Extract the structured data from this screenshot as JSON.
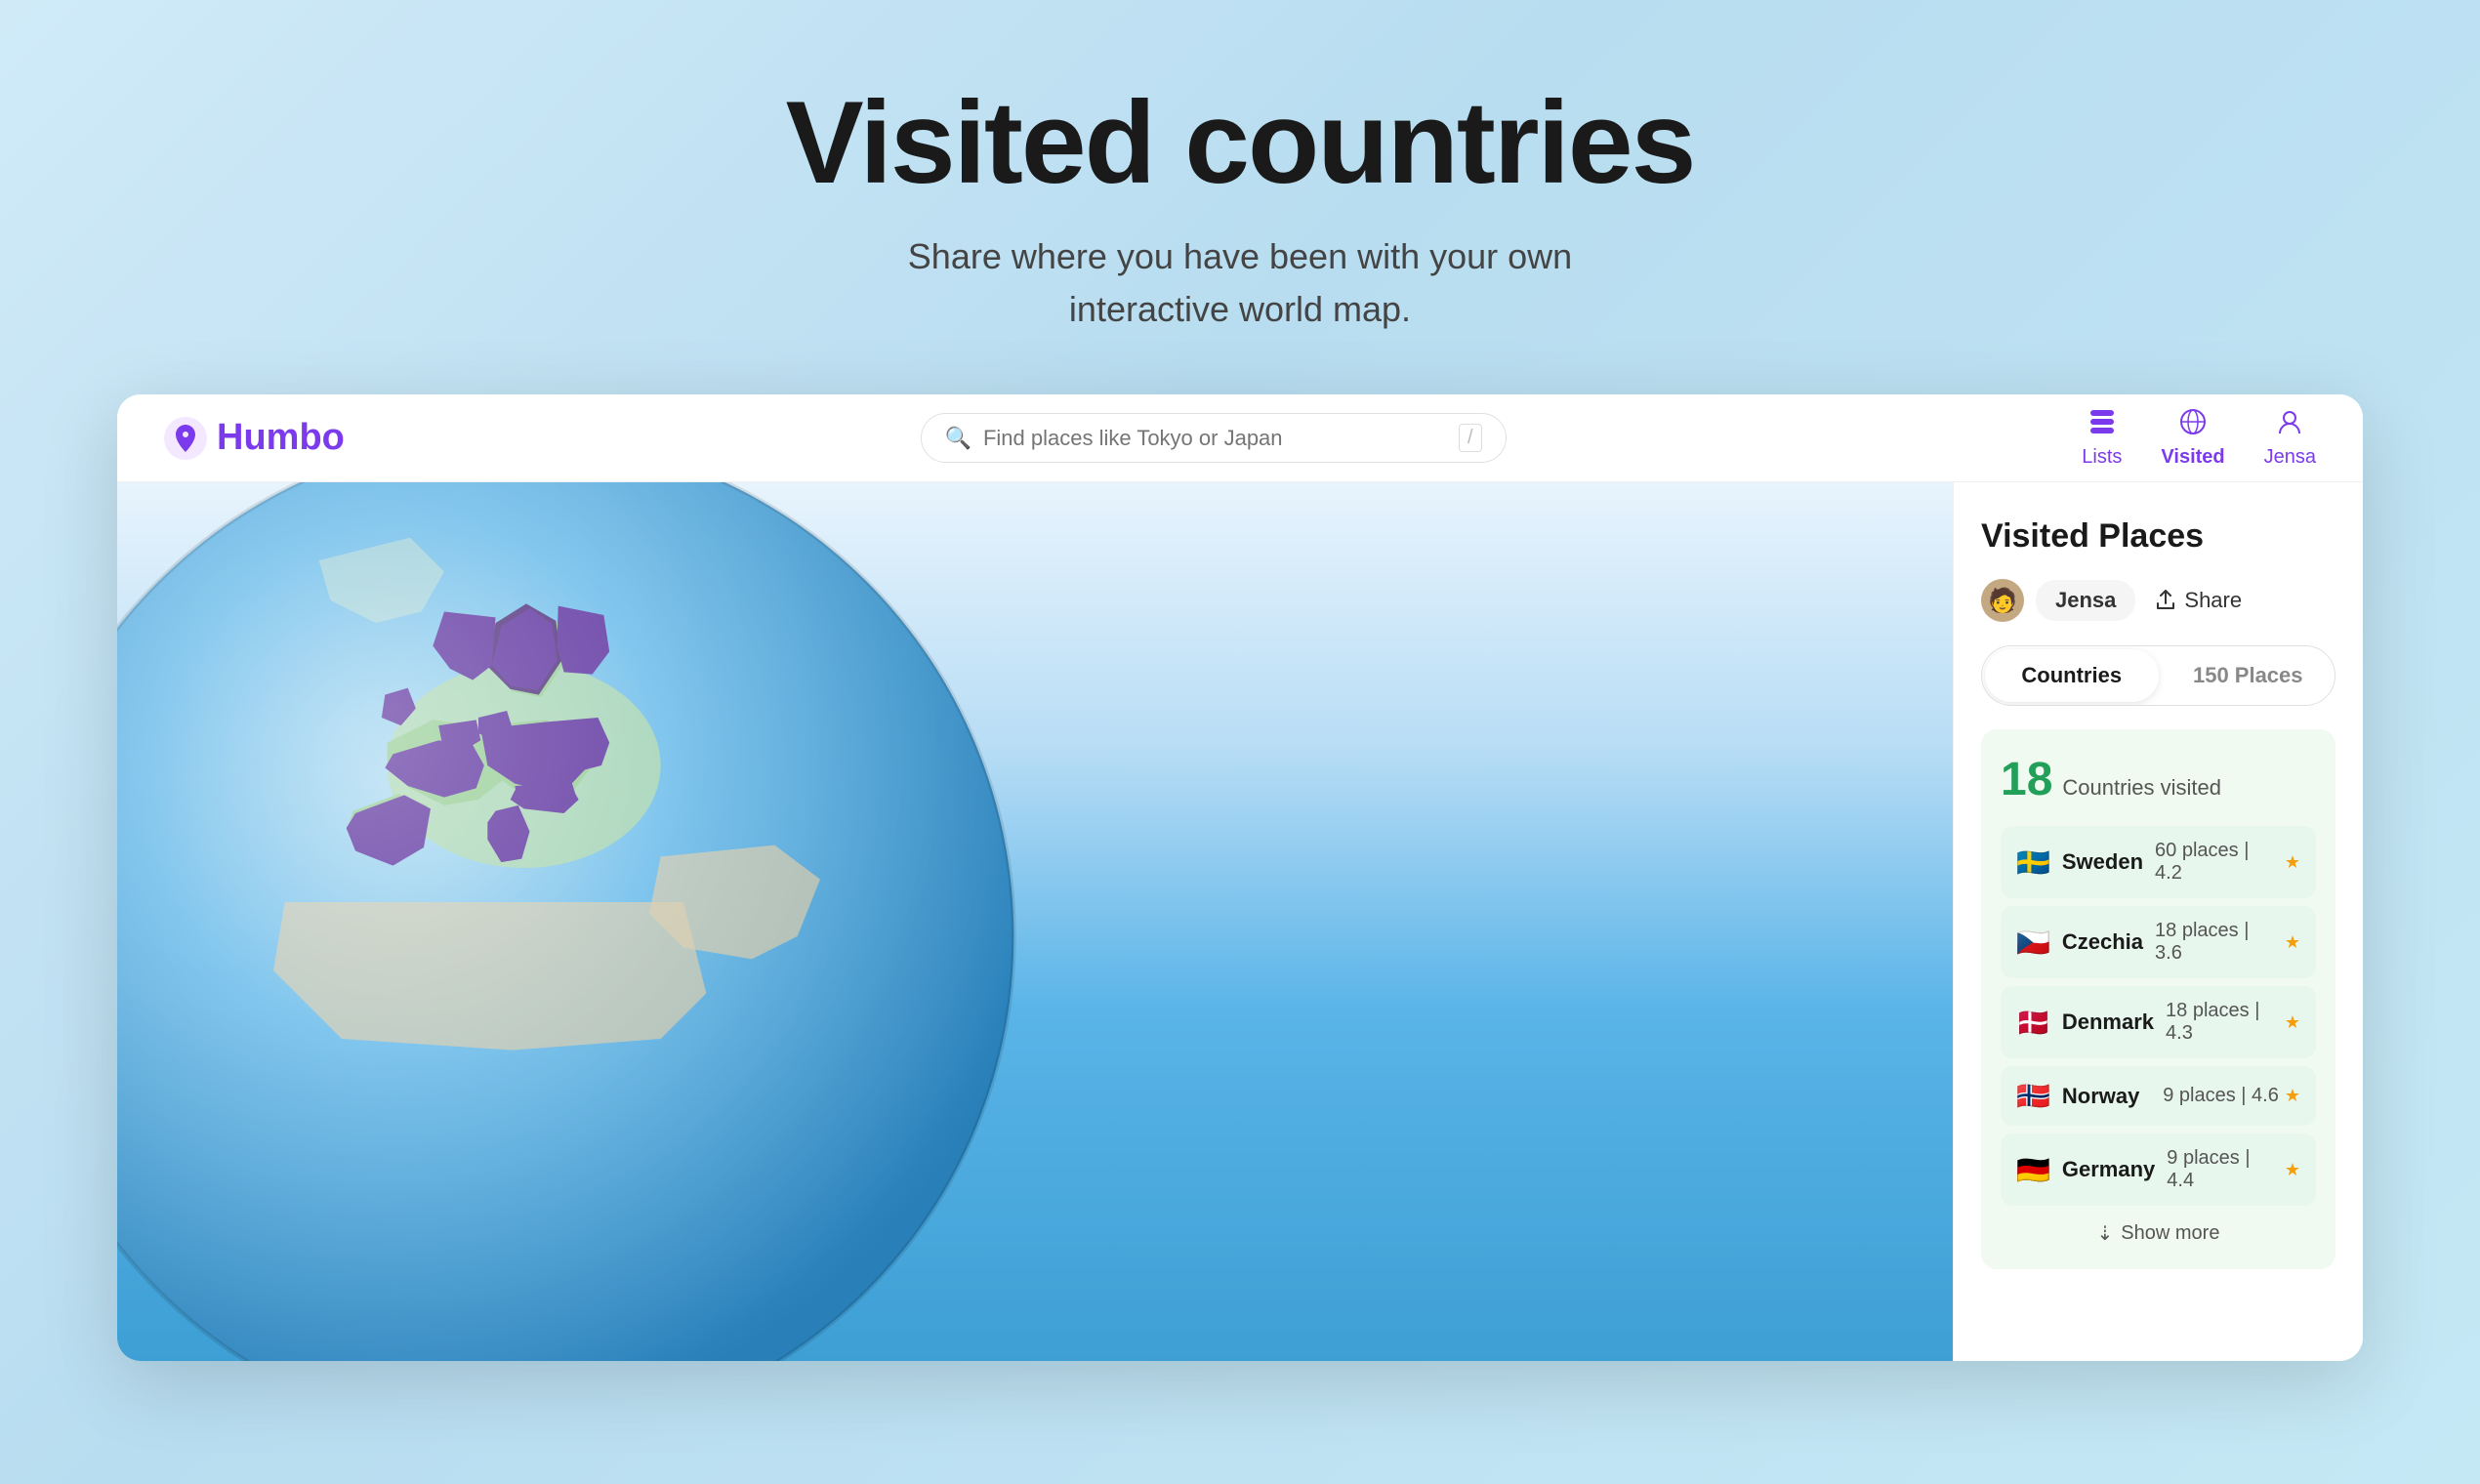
{
  "hero": {
    "title": "Visited countries",
    "subtitle": "Share where you have been with your own\ninteractive world map."
  },
  "navbar": {
    "logo": {
      "text": "Humbo"
    },
    "search": {
      "placeholder": "Find places like Tokyo or Japan",
      "slash": "/"
    },
    "nav_items": [
      {
        "label": "Lists",
        "icon": "📋"
      },
      {
        "label": "Visited",
        "icon": "🌐"
      },
      {
        "label": "Jensa",
        "icon": "👤"
      }
    ]
  },
  "sidebar": {
    "title": "Visited Places",
    "user": {
      "name": "Jensa"
    },
    "share_label": "Share",
    "tabs": [
      {
        "label": "Countries",
        "active": true
      },
      {
        "label": "150 Places",
        "active": false
      }
    ],
    "stats": {
      "count": "18",
      "label": "Countries visited"
    },
    "countries": [
      {
        "flag": "🇸🇪",
        "name": "Sweden",
        "places": "60 places",
        "rating": "4.2"
      },
      {
        "flag": "🇨🇿",
        "name": "Czechia",
        "places": "18 places",
        "rating": "3.6"
      },
      {
        "flag": "🇩🇰",
        "name": "Denmark",
        "places": "18 places",
        "rating": "4.3"
      },
      {
        "flag": "🇳🇴",
        "name": "Norway",
        "places": "9 places",
        "rating": "4.6"
      },
      {
        "flag": "🇩🇪",
        "name": "Germany",
        "places": "9 places",
        "rating": "4.4"
      }
    ],
    "show_more": "Show more"
  }
}
